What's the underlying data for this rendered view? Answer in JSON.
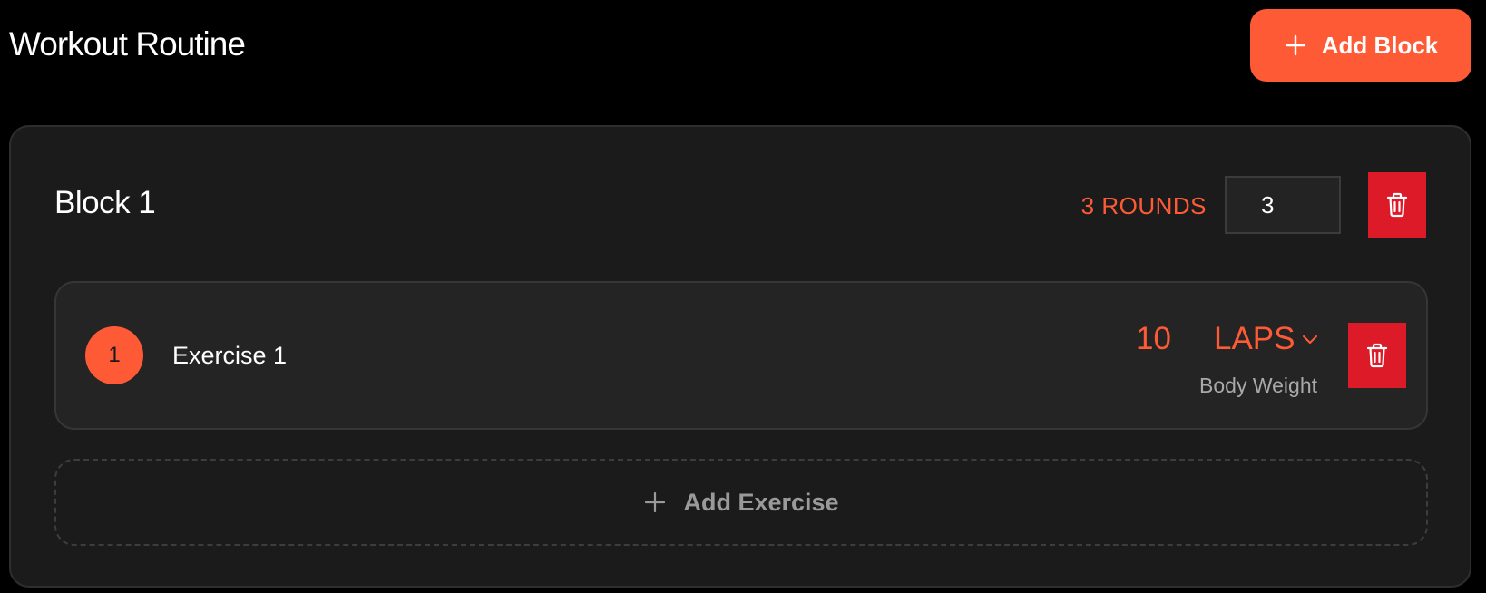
{
  "page": {
    "title": "Workout Routine",
    "add_block_label": "Add Block"
  },
  "colors": {
    "accent": "#ff5a36",
    "danger": "#dc1a28",
    "background": "#000000",
    "card": "#1b1b1b",
    "exercise_card": "#242424"
  },
  "blocks": [
    {
      "title": "Block 1",
      "rounds_label": "3 ROUNDS",
      "rounds_value": "3",
      "exercises": [
        {
          "number": "1",
          "name": "Exercise 1",
          "reps": "10",
          "unit": "LAPS",
          "type": "Body Weight"
        }
      ],
      "add_exercise_label": "Add Exercise"
    }
  ],
  "icons": {
    "add": "plus-icon",
    "delete": "trash-icon",
    "dropdown": "chevron-down-icon"
  }
}
